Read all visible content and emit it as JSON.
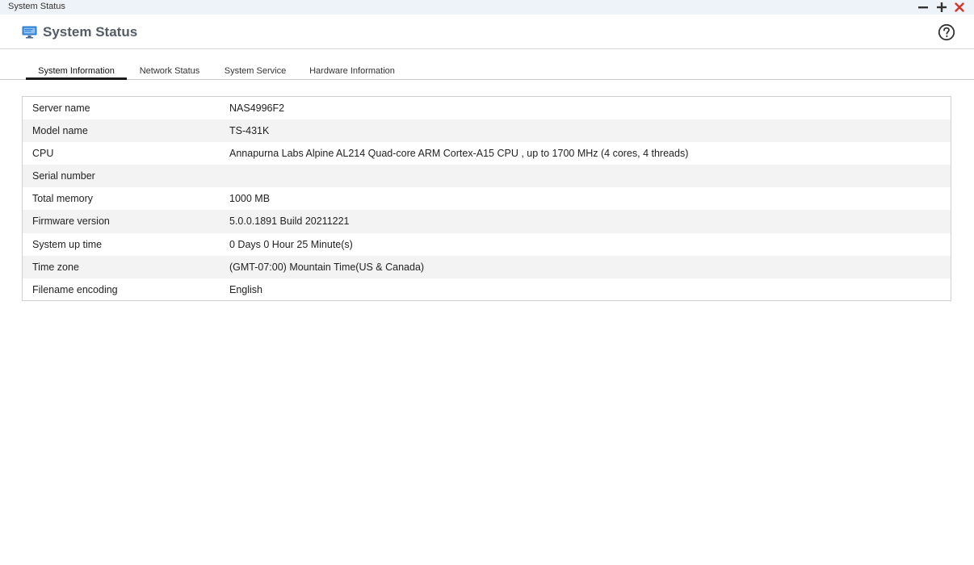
{
  "window": {
    "title": "System Status",
    "controls": [
      "minimize-icon",
      "maximize-icon",
      "close-icon"
    ]
  },
  "header": {
    "title": "System Status",
    "icon": "monitor-icon",
    "help_icon": "help-icon"
  },
  "tabs": [
    {
      "label": "System Information",
      "active": true
    },
    {
      "label": "Network Status",
      "active": false
    },
    {
      "label": "System Service",
      "active": false
    },
    {
      "label": "Hardware Information",
      "active": false
    }
  ],
  "info": [
    {
      "label": "Server name",
      "value": "NAS4996F2"
    },
    {
      "label": "Model name",
      "value": "TS-431K"
    },
    {
      "label": "CPU",
      "value": "Annapurna Labs Alpine AL214 Quad-core ARM Cortex-A15 CPU , up to 1700 MHz (4 cores, 4 threads)"
    },
    {
      "label": "Serial number",
      "value": ""
    },
    {
      "label": "Total memory",
      "value": "1000 MB"
    },
    {
      "label": "Firmware version",
      "value": "5.0.0.1891 Build 20211221"
    },
    {
      "label": "System up time",
      "value": "0 Days 0 Hour 25 Minute(s)"
    },
    {
      "label": "Time zone",
      "value": "(GMT-07:00) Mountain Time(US & Canada)"
    },
    {
      "label": "Filename encoding",
      "value": "English"
    }
  ],
  "colors": {
    "titlebar_bg": "#eef3f9",
    "close": "#d9342b",
    "app_icon": "#2f7fd1"
  }
}
